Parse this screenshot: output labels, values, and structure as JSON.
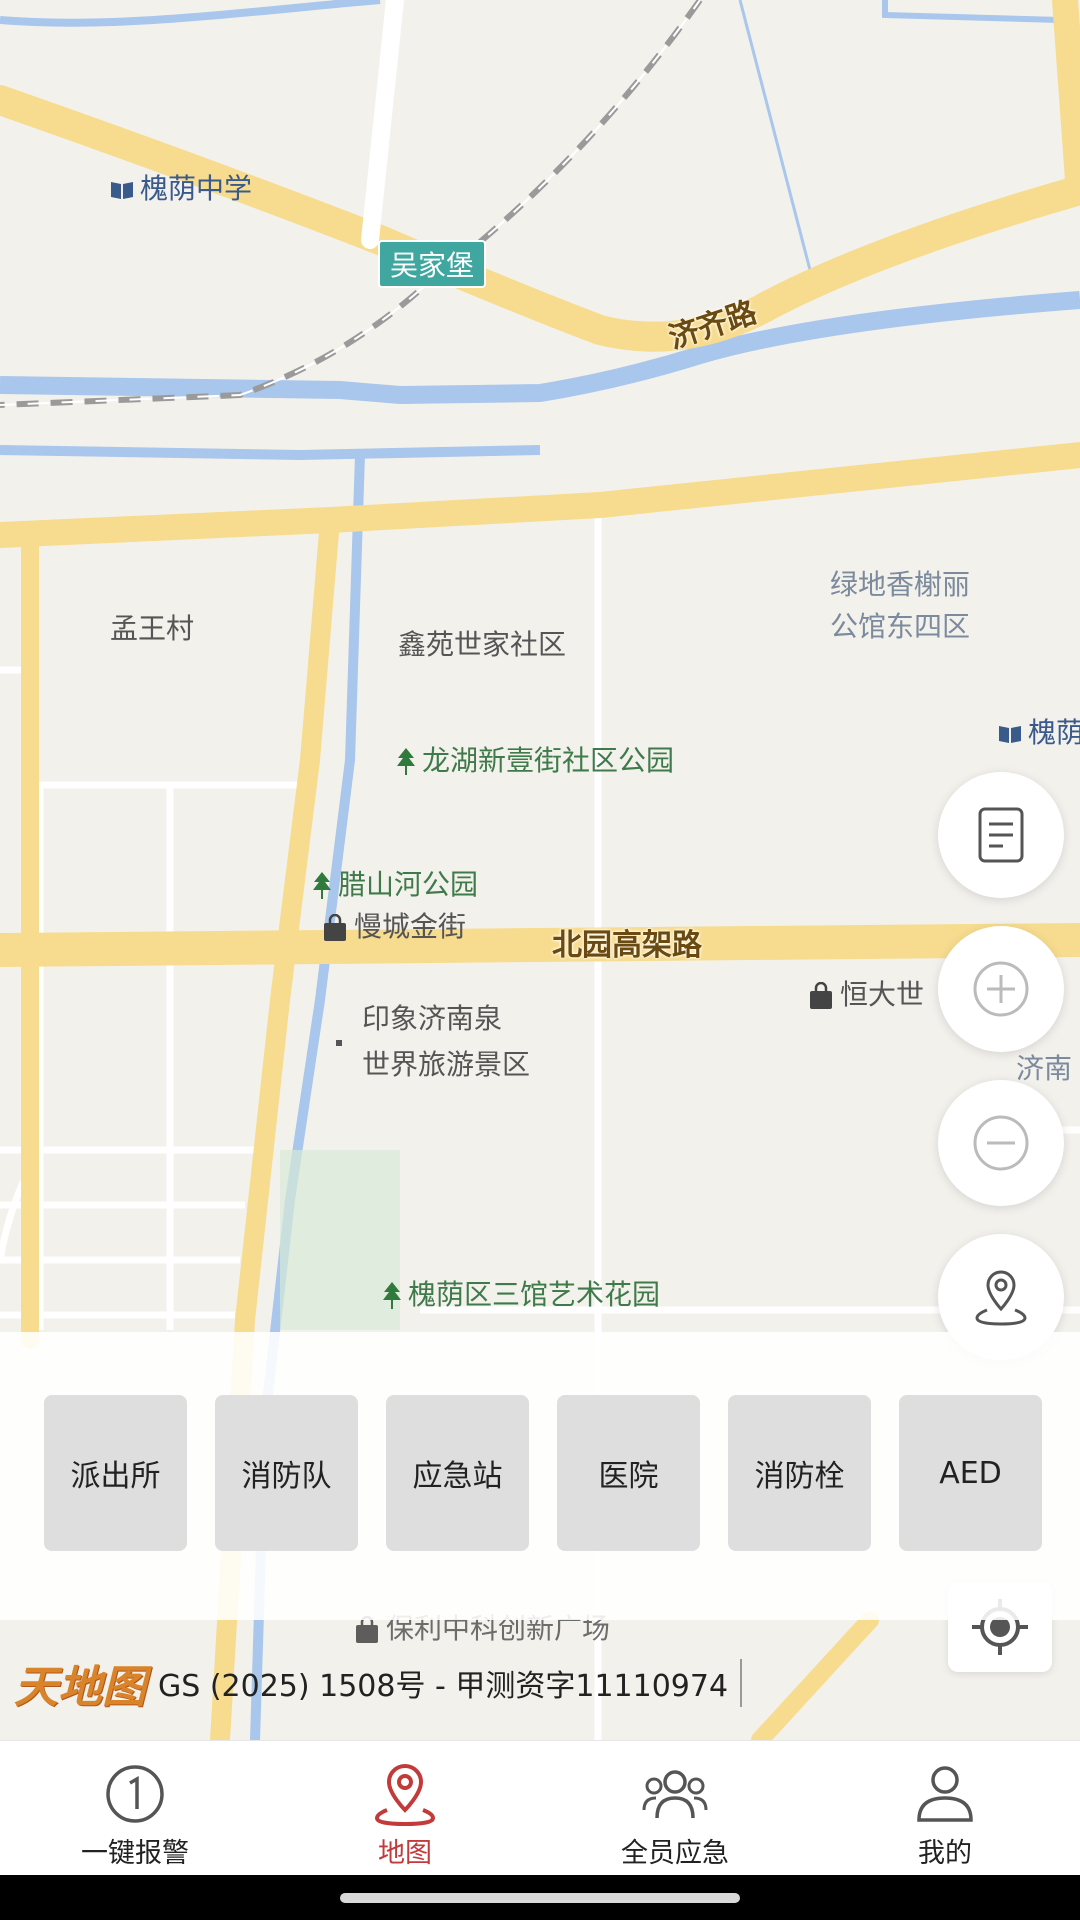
{
  "map": {
    "labels": {
      "school1": "槐荫中学",
      "station": "吴家堡",
      "road_jiqi": "济齐路",
      "village": "孟王村",
      "community": "鑫苑世家社区",
      "greenland1": "绿地香榭丽",
      "greenland2": "公馆东四区",
      "school2": "槐荫",
      "park_longhu": "龙湖新壹街社区公园",
      "park_lashan": "腊山河公园",
      "mall": "慢城金街",
      "road_beiyuan": "北园高架路",
      "hengda": "恒大世",
      "jinan1": "济南",
      "jinan2": "场",
      "scenic1": "印象济南泉",
      "scenic2": "世界旅游景区",
      "park_sanguan": "槐荫区三馆艺术花园",
      "poly": "保利中科创新广场"
    }
  },
  "categories": [
    "派出所",
    "消防队",
    "应急站",
    "医院",
    "消防栓",
    "AED"
  ],
  "attribution": {
    "logo": "天地图",
    "license": "GS (2025) 1508号 - 甲测资字11110974"
  },
  "nav": {
    "alarm": "一键报警",
    "map": "地图",
    "emergency": "全员应急",
    "mine": "我的"
  },
  "colors": {
    "accent": "#c23a3a",
    "road": "#f7dc8f",
    "water": "#a9c6ec",
    "park": "#3f7a4a"
  }
}
